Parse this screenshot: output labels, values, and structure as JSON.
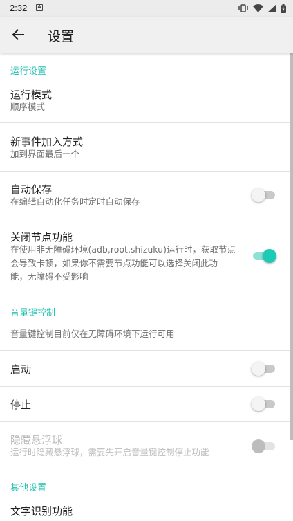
{
  "status_bar": {
    "time": "2:32",
    "notification_glyph": "A"
  },
  "app_bar": {
    "title": "设置",
    "back_icon": "arrow-left-icon"
  },
  "sections": {
    "run": {
      "header": "运行设置",
      "run_mode": {
        "title": "运行模式",
        "summary": "顺序模式"
      },
      "new_event": {
        "title": "新事件加入方式",
        "summary": "加到界面最后一个"
      },
      "auto_save": {
        "title": "自动保存",
        "summary": "在编辑自动化任务时定时自动保存",
        "checked": false
      },
      "close_node": {
        "title": "关闭节点功能",
        "summary_line1": "在使用非无障碍环境(adb,root,shizuku)运行时，获取节点",
        "summary_line2": "会导致卡顿，如果你不需要节点功能可以选择关闭此功",
        "summary_line3": "能，无障碍不受影响",
        "checked": true
      }
    },
    "volume": {
      "header": "音量键控制",
      "note": "音量键控制目前仅在无障碍环境下运行可用",
      "start": {
        "title": "启动",
        "checked": false
      },
      "stop": {
        "title": "停止",
        "checked": false
      },
      "hide_ball": {
        "title": "隐藏悬浮球",
        "summary": "运行时隐藏悬浮球，需要先开启音量键控制停止功能",
        "checked": false,
        "enabled": false
      }
    },
    "other": {
      "header": "其他设置",
      "ocr": {
        "title": "文字识别功能"
      }
    }
  },
  "colors": {
    "accent": "#1fbfb0",
    "switch_on": "#1ccbb6",
    "appbar_bg": "#f0f0f0"
  }
}
